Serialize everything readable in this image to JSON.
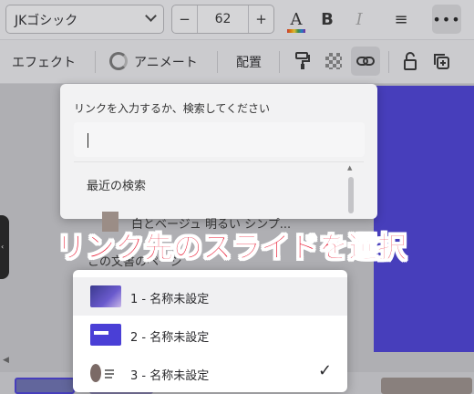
{
  "toolbar": {
    "font_name": "JKゴシック",
    "font_size": "62",
    "minus": "−",
    "plus": "+",
    "bold": "B",
    "italic": "I",
    "text_color_glyph": "A",
    "align_glyph": "≡",
    "more_glyph": "•••"
  },
  "toolbar2": {
    "effect": "エフェクト",
    "animate": "アニメート",
    "position": "配置"
  },
  "link_popup": {
    "prompt": "リンクを入力するか、検索してください",
    "search_value": "",
    "recent_title": "最近の検索",
    "recent_item": "白とベージュ 明るい シンプ...",
    "page_section_title": "この文書のページ"
  },
  "annotation": "リンク先のスライドを選択",
  "pages": [
    {
      "label": "1 - 名称未設定",
      "selected": false
    },
    {
      "label": "2 - 名称未設定",
      "selected": false
    },
    {
      "label": "3 - 名称未設定",
      "selected": true
    }
  ],
  "colors": {
    "accent": "#4a3fd6",
    "annotation_red": "#e8102a"
  },
  "icons": [
    "chevron-down-icon",
    "text-color-icon",
    "bold-icon",
    "italic-icon",
    "align-icon",
    "more-icon",
    "animate-icon",
    "paint-roller-icon",
    "transparency-icon",
    "link-icon",
    "lock-icon",
    "duplicate-icon",
    "check-icon"
  ]
}
